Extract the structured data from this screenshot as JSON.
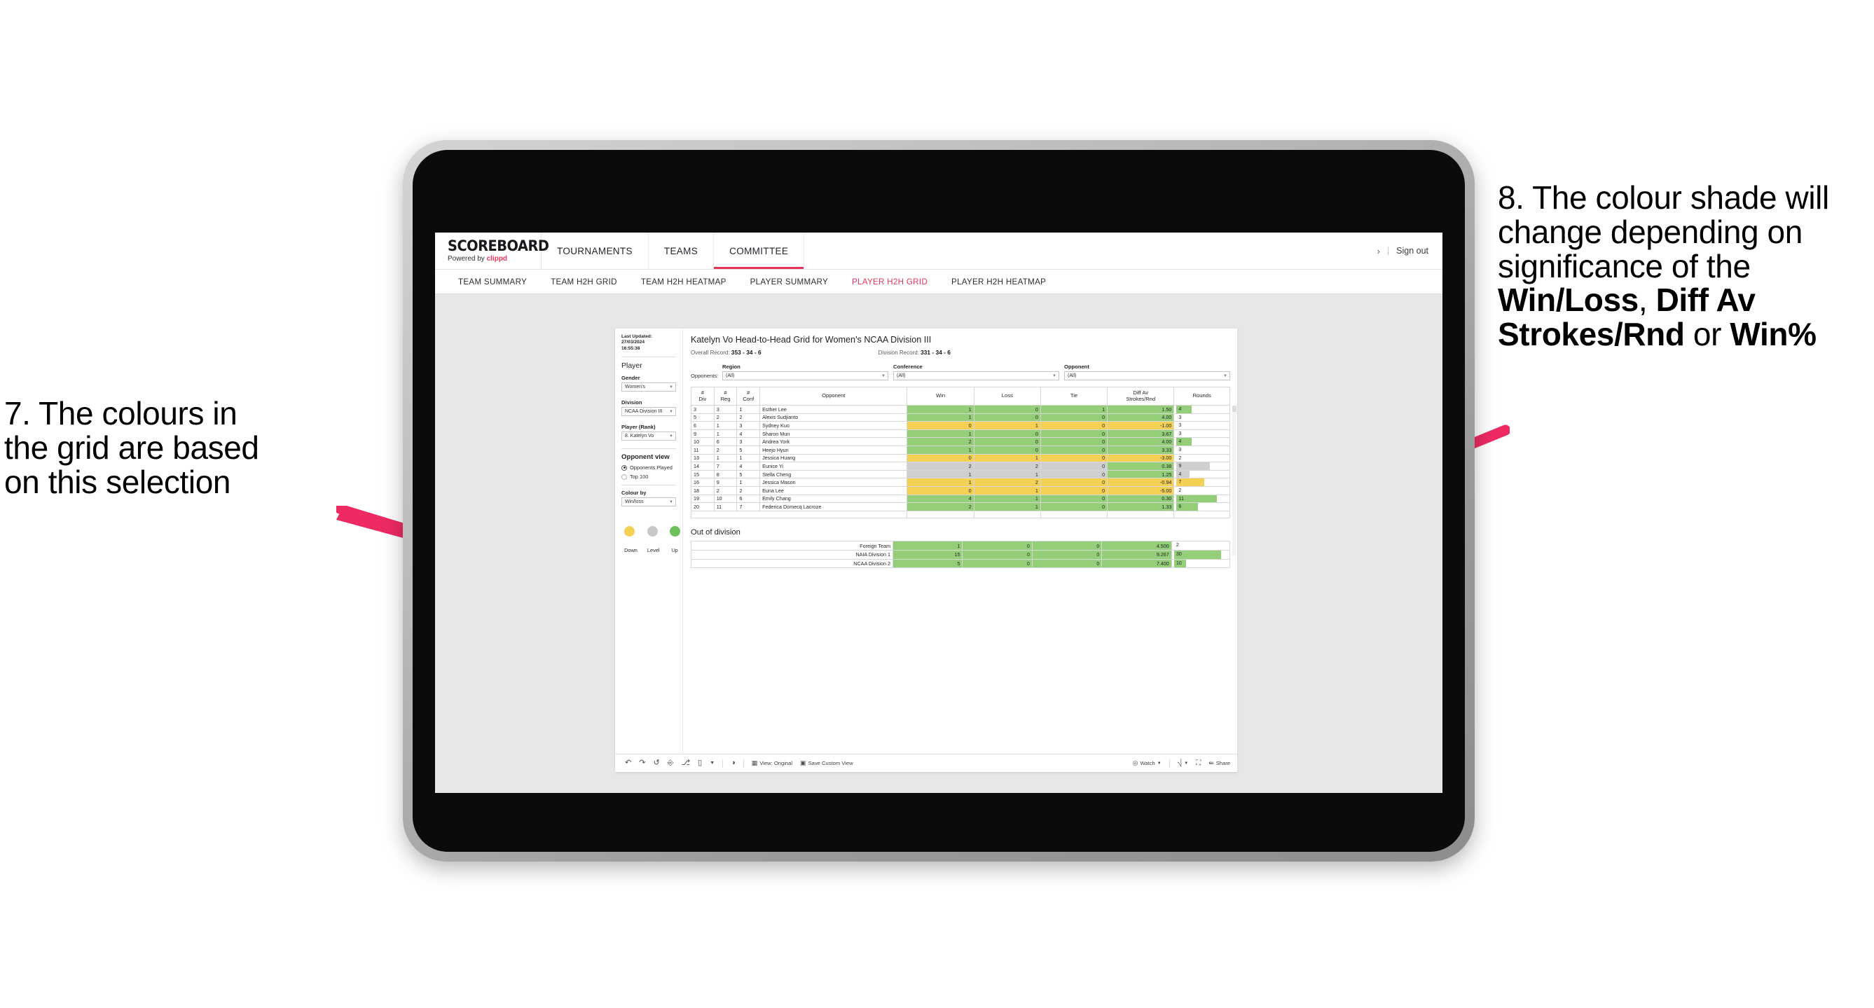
{
  "annotations": {
    "left": {
      "name": "callout-7",
      "lines": [
        "7. The colours in",
        "the grid are based",
        "on this selection"
      ]
    },
    "right": {
      "name": "callout-8",
      "segments": [
        {
          "text": "8. The colour shade will change depending on significance of the ",
          "bold": false
        },
        {
          "text": "Win/Loss",
          "bold": true
        },
        {
          "text": ", ",
          "bold": false
        },
        {
          "text": "Diff Av Strokes/Rnd",
          "bold": true
        },
        {
          "text": " or ",
          "bold": false
        },
        {
          "text": "Win%",
          "bold": true
        }
      ]
    },
    "arrow_color": "#ee2a63"
  },
  "appbar": {
    "brand_name": "SCOREBOARD",
    "brand_powered_prefix": "Powered by ",
    "brand_powered_brand": "clippd",
    "nav": [
      {
        "label": "TOURNAMENTS",
        "active": false
      },
      {
        "label": "TEAMS",
        "active": false
      },
      {
        "label": "COMMITTEE",
        "active": true
      }
    ],
    "chevron": "›",
    "separator": "|",
    "signout": "Sign out"
  },
  "subtabs": [
    {
      "label": "TEAM SUMMARY",
      "active": false
    },
    {
      "label": "TEAM H2H GRID",
      "active": false
    },
    {
      "label": "TEAM H2H HEATMAP",
      "active": false
    },
    {
      "label": "PLAYER SUMMARY",
      "active": false
    },
    {
      "label": "PLAYER H2H GRID",
      "active": true
    },
    {
      "label": "PLAYER H2H HEATMAP",
      "active": false
    }
  ],
  "panel": {
    "last_updated_line1": "Last Updated: 27/03/2024",
    "last_updated_line2": "16:55:38",
    "player_heading": "Player",
    "fields": [
      {
        "label": "Gender",
        "value": "Women’s"
      },
      {
        "label": "Division",
        "value": "NCAA Division III"
      },
      {
        "label": "Player (Rank)",
        "value": "8. Katelyn Vo"
      }
    ],
    "opponent_view_heading": "Opponent view",
    "opponent_view_options": [
      {
        "label": "Opponents Played",
        "selected": true
      },
      {
        "label": "Top 100",
        "selected": false
      }
    ],
    "colour_by_label": "Colour by",
    "colour_by_value": "Win/loss",
    "legend": [
      {
        "label": "Down",
        "color": "#f4d154"
      },
      {
        "label": "Level",
        "color": "#c7c8ca"
      },
      {
        "label": "Up",
        "color": "#6cbf59"
      }
    ]
  },
  "main": {
    "title": "Katelyn Vo Head-to-Head Grid for Women’s NCAA Division III",
    "overall_record_label": "Overall Record: ",
    "overall_record_value": "353 -  34 - 6",
    "division_record_label": "Division Record: ",
    "division_record_value": "331 -  34 - 6",
    "opponents_label": "Opponents:",
    "opponent_filters": [
      {
        "caption": "Region",
        "value": "(All)"
      },
      {
        "caption": "Conference",
        "value": "(All)"
      },
      {
        "caption": "Opponent",
        "value": "(All)"
      }
    ],
    "out_of_division_title": "Out of division"
  },
  "chart_data": {
    "type": "table",
    "title": "Katelyn Vo Head-to-Head Grid for Women’s NCAA Division III",
    "columns": [
      "# Div",
      "# Reg",
      "# Conf",
      "Opponent",
      "Win",
      "Loss",
      "Tie",
      "Diff Av Strokes/Rnd",
      "Rounds"
    ],
    "column_header_lines": [
      [
        "#",
        "Div"
      ],
      [
        "#",
        "Reg"
      ],
      [
        "#",
        "Conf"
      ],
      [
        "Opponent"
      ],
      [
        "Win"
      ],
      [
        "Loss"
      ],
      [
        "Tie"
      ],
      [
        "Diff Av",
        "Strokes/Rnd"
      ],
      [
        "Rounds"
      ]
    ],
    "rows": [
      {
        "div": "3",
        "reg": "3",
        "conf": "1",
        "opponent": "Esther Lee",
        "win": "1",
        "loss": "0",
        "tie": "1",
        "diff": "1.50",
        "rounds": "4",
        "fill": "green",
        "bar_pct": 30
      },
      {
        "div": "5",
        "reg": "2",
        "conf": "2",
        "opponent": "Alexis Sudjianto",
        "win": "1",
        "loss": "0",
        "tie": "0",
        "diff": "4.00",
        "rounds": "3",
        "fill": "green",
        "bar_pct": 0
      },
      {
        "div": "6",
        "reg": "1",
        "conf": "3",
        "opponent": "Sydney Kuo",
        "win": "0",
        "loss": "1",
        "tie": "0",
        "diff": "-1.00",
        "rounds": "3",
        "fill": "yellow",
        "bar_pct": 0
      },
      {
        "div": "9",
        "reg": "1",
        "conf": "4",
        "opponent": "Sharon Mun",
        "win": "1",
        "loss": "0",
        "tie": "0",
        "diff": "3.67",
        "rounds": "3",
        "fill": "green",
        "bar_pct": 0
      },
      {
        "div": "10",
        "reg": "6",
        "conf": "3",
        "opponent": "Andrea York",
        "win": "2",
        "loss": "0",
        "tie": "0",
        "diff": "4.00",
        "rounds": "4",
        "fill": "green",
        "bar_pct": 30
      },
      {
        "div": "11",
        "reg": "2",
        "conf": "5",
        "opponent": "Heejo Hyun",
        "win": "1",
        "loss": "0",
        "tie": "0",
        "diff": "3.33",
        "rounds": "3",
        "fill": "green",
        "bar_pct": 0
      },
      {
        "div": "13",
        "reg": "1",
        "conf": "1",
        "opponent": "Jessica Huang",
        "win": "0",
        "loss": "1",
        "tie": "0",
        "diff": "-3.00",
        "rounds": "2",
        "fill": "yellow",
        "bar_pct": 0
      },
      {
        "div": "14",
        "reg": "7",
        "conf": "4",
        "opponent": "Eunice Yi",
        "win": "2",
        "loss": "2",
        "tie": "0",
        "diff": "0.38",
        "rounds": "9",
        "fill": "grey",
        "diff_fill": "green",
        "bar_pct": 66
      },
      {
        "div": "15",
        "reg": "8",
        "conf": "5",
        "opponent": "Stella Cheng",
        "win": "1",
        "loss": "1",
        "tie": "0",
        "diff": "1.25",
        "rounds": "4",
        "fill": "grey",
        "diff_fill": "green",
        "bar_pct": 26
      },
      {
        "div": "16",
        "reg": "9",
        "conf": "1",
        "opponent": "Jessica Mason",
        "win": "1",
        "loss": "2",
        "tie": "0",
        "diff": "-0.94",
        "rounds": "7",
        "fill": "yellow",
        "bar_pct": 54
      },
      {
        "div": "18",
        "reg": "2",
        "conf": "2",
        "opponent": "Euna Lee",
        "win": "0",
        "loss": "1",
        "tie": "0",
        "diff": "-5.00",
        "rounds": "2",
        "fill": "yellow",
        "bar_pct": 0
      },
      {
        "div": "19",
        "reg": "10",
        "conf": "6",
        "opponent": "Emily Chang",
        "win": "4",
        "loss": "1",
        "tie": "0",
        "diff": "0.30",
        "rounds": "11",
        "fill": "green",
        "bar_pct": 80
      },
      {
        "div": "20",
        "reg": "11",
        "conf": "7",
        "opponent": "Federica Domecq Lacroze",
        "win": "2",
        "loss": "1",
        "tie": "0",
        "diff": "1.33",
        "rounds": "6",
        "fill": "green",
        "bar_pct": 42
      }
    ],
    "out_of_division": {
      "title": "Out of division",
      "rows": [
        {
          "name": "Foreign Team",
          "win": "1",
          "loss": "0",
          "tie": "0",
          "diff": "4.500",
          "rounds": "2",
          "fill": "green",
          "bar_pct": 0
        },
        {
          "name": "NAIA Division 1",
          "win": "15",
          "loss": "0",
          "tie": "0",
          "diff": "9.267",
          "rounds": "30",
          "fill": "green",
          "bar_pct": 88
        },
        {
          "name": "NCAA Division 2",
          "win": "5",
          "loss": "0",
          "tie": "0",
          "diff": "7.400",
          "rounds": "10",
          "fill": "green",
          "bar_pct": 22
        }
      ]
    },
    "colors": {
      "green": "#94ce79",
      "yellow": "#f4d154",
      "grey": "#cfcfcf",
      "accent": "#e8345a"
    }
  },
  "toolbar": {
    "icons": [
      "undo-icon",
      "redo-icon",
      "revert-icon",
      "refresh-data-icon",
      "pause-icon",
      "layout-icon",
      "caret-icon",
      "info-icon"
    ],
    "view_label": "View: Original",
    "save_label": "Save Custom View",
    "watch_label": "Watch",
    "share_label": "Share"
  }
}
